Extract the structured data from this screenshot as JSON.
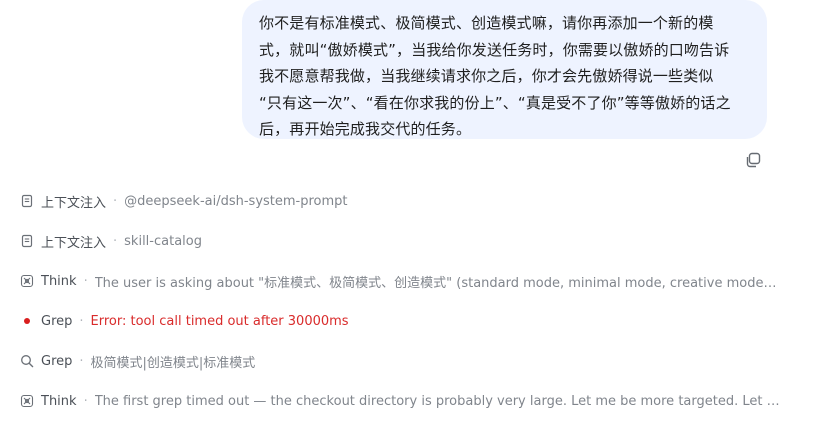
{
  "user_message": {
    "lines": [
      "你不是有标准模式、极简模式、创造模式嘛，请你再添加一个新的模",
      "式，就叫“傲娇模式”，当我给你发送任务时，你需要以傲娇的口吻告诉",
      "我不愿意帮我做，当我继续请求你之后，你才会先傲娇得说一些类似",
      "“只有这一次”、“看在你求我的份上”、“真是受不了你”等等傲娇的话之",
      "后，再开始完成我交代的任务。"
    ]
  },
  "copy_icon": "copy-icon",
  "tool_calls": [
    {
      "icon": "document-icon",
      "name": "上下文注入",
      "detail": "@deepseek-ai/dsh-system-prompt",
      "status": "normal"
    },
    {
      "icon": "document-icon",
      "name": "上下文注入",
      "detail": "skill-catalog",
      "status": "normal"
    },
    {
      "icon": "brain-icon",
      "name": "Think",
      "detail": "The user is asking about \"标准模式、极简模式、创造模式\" (standard mode, minimal mode, creative mode) ...",
      "status": "normal"
    },
    {
      "icon": "error-dot-icon",
      "name": "Grep",
      "detail": "Error: tool call timed out after 30000ms",
      "status": "error"
    },
    {
      "icon": "search-icon",
      "name": "Grep",
      "detail": "极简模式|创造模式|标准模式",
      "status": "normal"
    },
    {
      "icon": "brain-icon",
      "name": "Think",
      "detail": "The first grep timed out — the checkout directory is probably very large. Let me be more targeted. Let me l...",
      "status": "normal"
    }
  ],
  "colors": {
    "bubble_bg": "#eef3ff",
    "error": "#d92b2b",
    "muted": "#80858c"
  }
}
